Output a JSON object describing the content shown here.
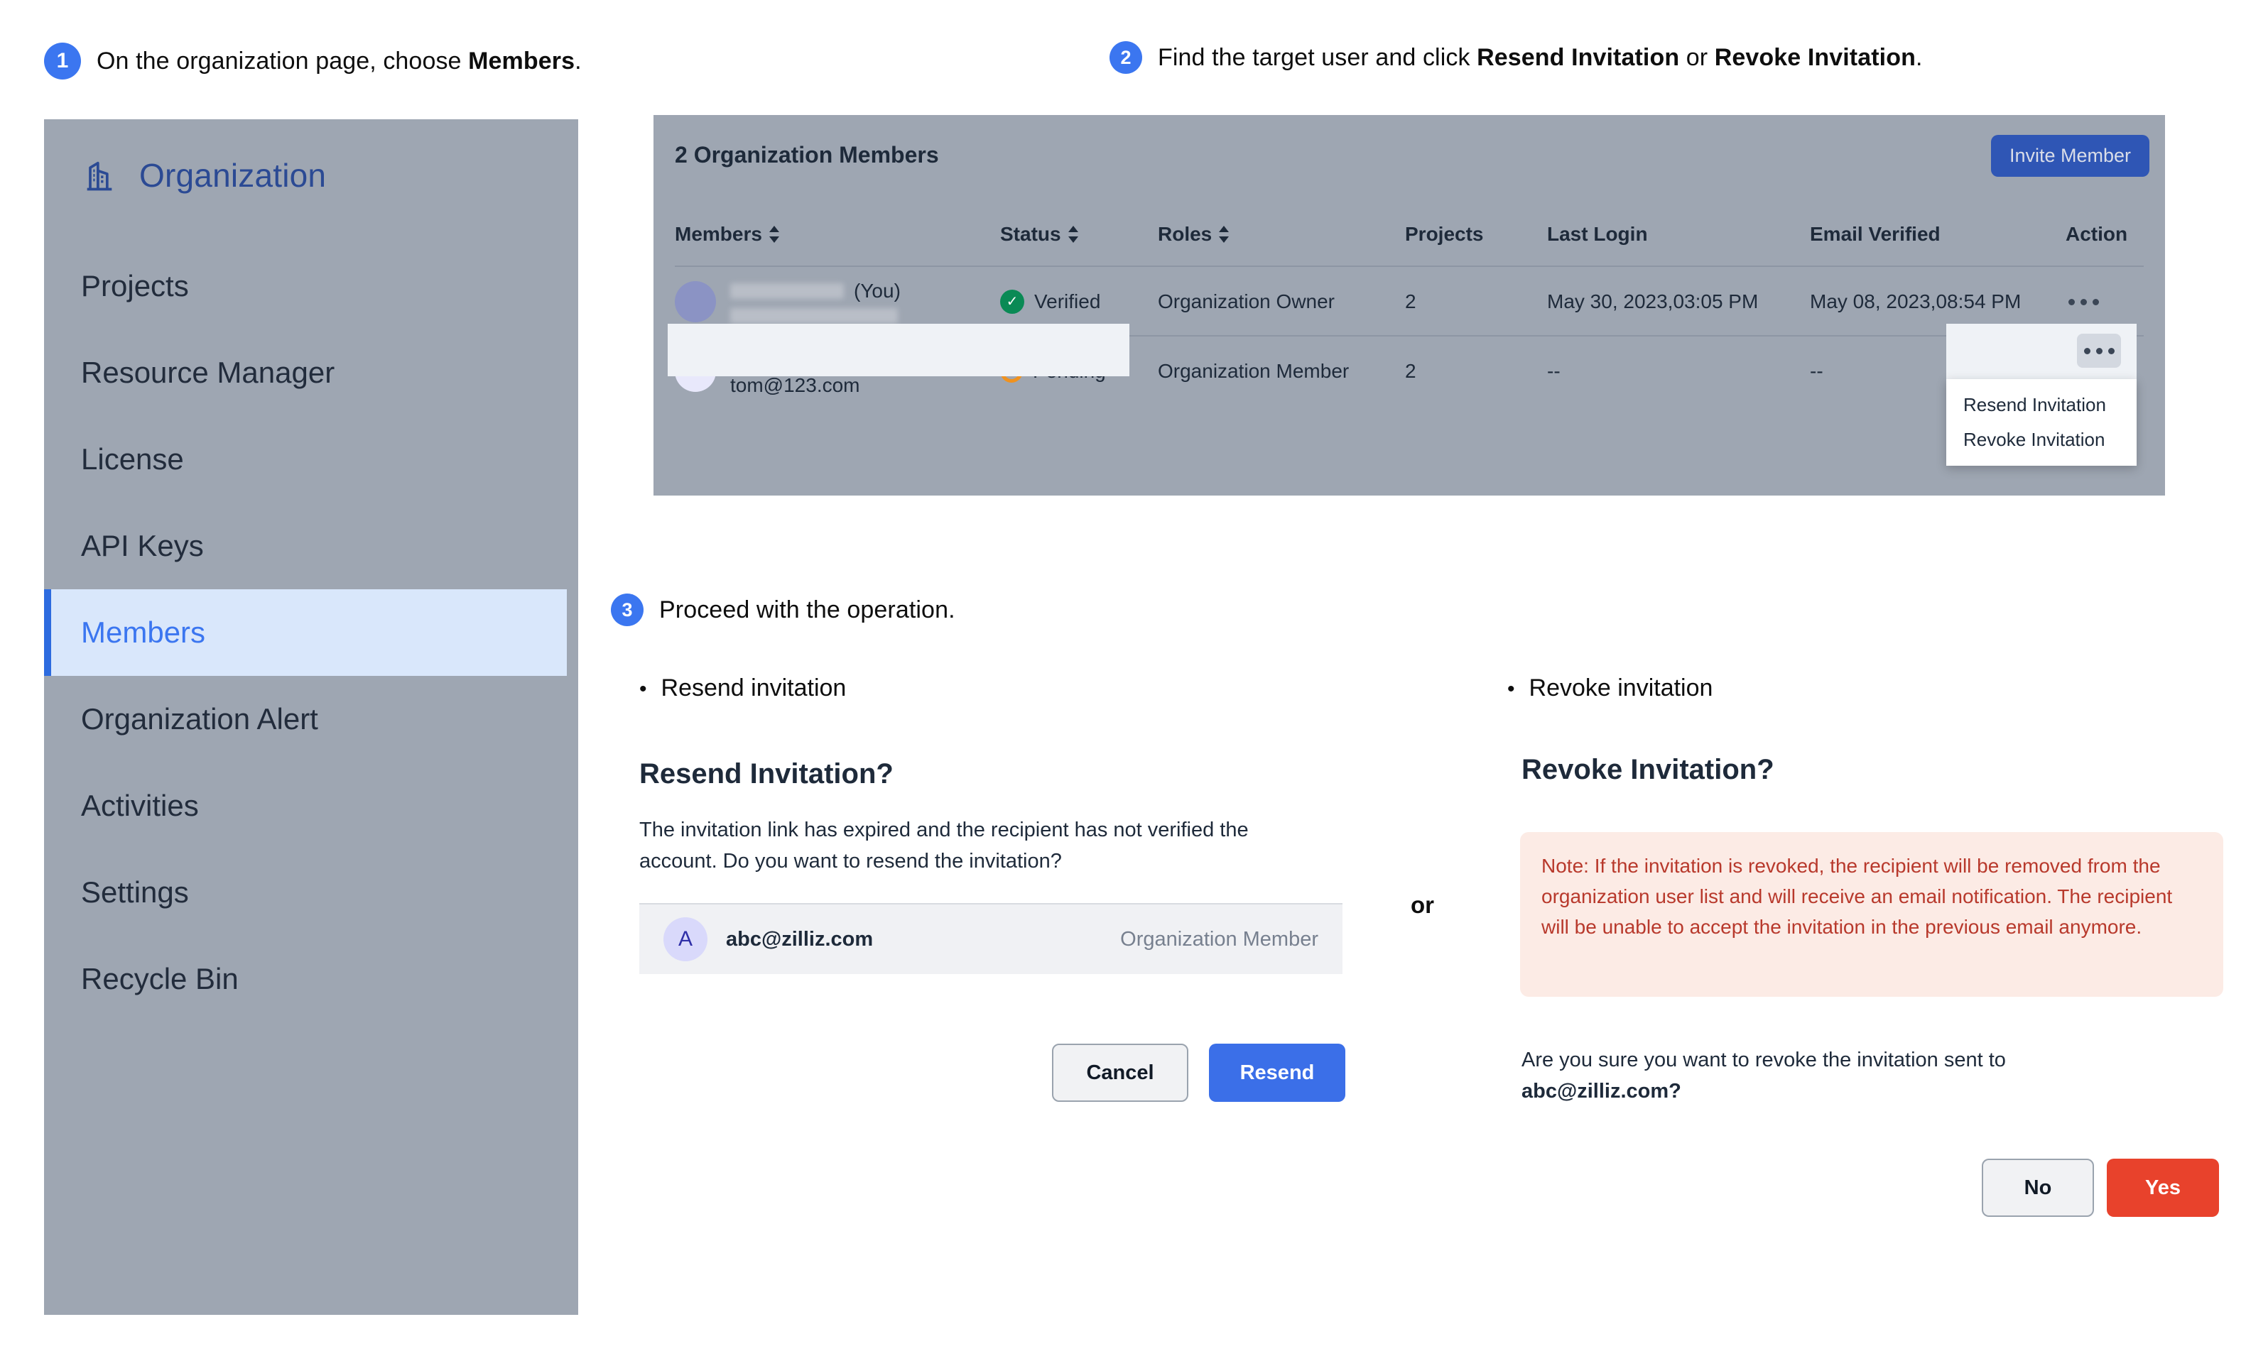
{
  "steps": [
    {
      "number": "1",
      "text_before": "On the organization page, choose ",
      "bold": "Members",
      "text_after": "."
    },
    {
      "number": "2",
      "text_before": "Find the target user and click ",
      "bold": "Resend Invitation",
      "middle": " or ",
      "bold2": "Revoke Invitation",
      "text_after": "."
    },
    {
      "number": "3",
      "text_before": "Proceed with the operation.",
      "bold": "",
      "text_after": ""
    }
  ],
  "sidebar": {
    "icon": "building-icon",
    "title": "Organization",
    "items": [
      {
        "label": "Projects",
        "active": false
      },
      {
        "label": "Resource Manager",
        "active": false
      },
      {
        "label": "License",
        "active": false
      },
      {
        "label": "API Keys",
        "active": false
      },
      {
        "label": "Members",
        "active": true
      },
      {
        "label": "Organization Alert",
        "active": false
      },
      {
        "label": "Activities",
        "active": false
      },
      {
        "label": "Settings",
        "active": false
      },
      {
        "label": "Recycle Bin",
        "active": false
      }
    ]
  },
  "members_panel": {
    "title": "2 Organization Members",
    "invite_button": "Invite Member",
    "columns": [
      {
        "label": "Members",
        "sortable": true
      },
      {
        "label": "Status",
        "sortable": true
      },
      {
        "label": "Roles",
        "sortable": true
      },
      {
        "label": "Projects",
        "sortable": false
      },
      {
        "label": "Last Login",
        "sortable": false
      },
      {
        "label": "Email Verified",
        "sortable": false
      },
      {
        "label": "Action",
        "sortable": false
      }
    ],
    "rows": [
      {
        "name": "",
        "you_tag": "(You)",
        "email": "",
        "blurred": true,
        "status": "Verified",
        "status_type": "verified",
        "role": "Organization Owner",
        "projects": "2",
        "last_login": "May 30, 2023,03:05 PM",
        "email_verified": "May 08, 2023,08:54 PM",
        "action": "more-options"
      },
      {
        "name": "--",
        "you_tag": "",
        "email": "tom@123.com",
        "blurred": false,
        "status": "Pending",
        "status_type": "pending",
        "role": "Organization Member",
        "projects": "2",
        "last_login": "--",
        "email_verified": "--",
        "action": "more-options"
      }
    ],
    "dropdown": {
      "items": [
        "Resend Invitation",
        "Revoke Invitation"
      ]
    }
  },
  "resend": {
    "bullet": "Resend invitation",
    "title": "Resend Invitation?",
    "body": "The invitation link has expired and the recipient has not verified the account. Do you want to resend the invitation?",
    "recipient": {
      "initial": "A",
      "email": "abc@zilliz.com",
      "role": "Organization Member"
    },
    "cancel_label": "Cancel",
    "confirm_label": "Resend"
  },
  "or_label": "or",
  "revoke": {
    "bullet": "Revoke invitation",
    "title": "Revoke Invitation?",
    "note": "Note: If the invitation is revoked, the recipient will be removed from the organization user list and will receive an email notification. The recipient will be unable to accept the invitation in the previous email anymore.",
    "question_line1": "Are you sure you want to revoke the invitation sent to",
    "question_email": "abc@zilliz.com?",
    "no_label": "No",
    "yes_label": "Yes"
  },
  "colors": {
    "accent_blue": "#3b76f0",
    "sidebar_bg": "#9ea6b2",
    "active_item_bg": "#d9e7fb",
    "primary_button": "#3b6fe8",
    "danger_button": "#e8422c",
    "note_bg": "#fcebe5",
    "note_text": "#b8392c",
    "verified_green": "#0a8a55",
    "pending_orange": "#f0921f"
  }
}
